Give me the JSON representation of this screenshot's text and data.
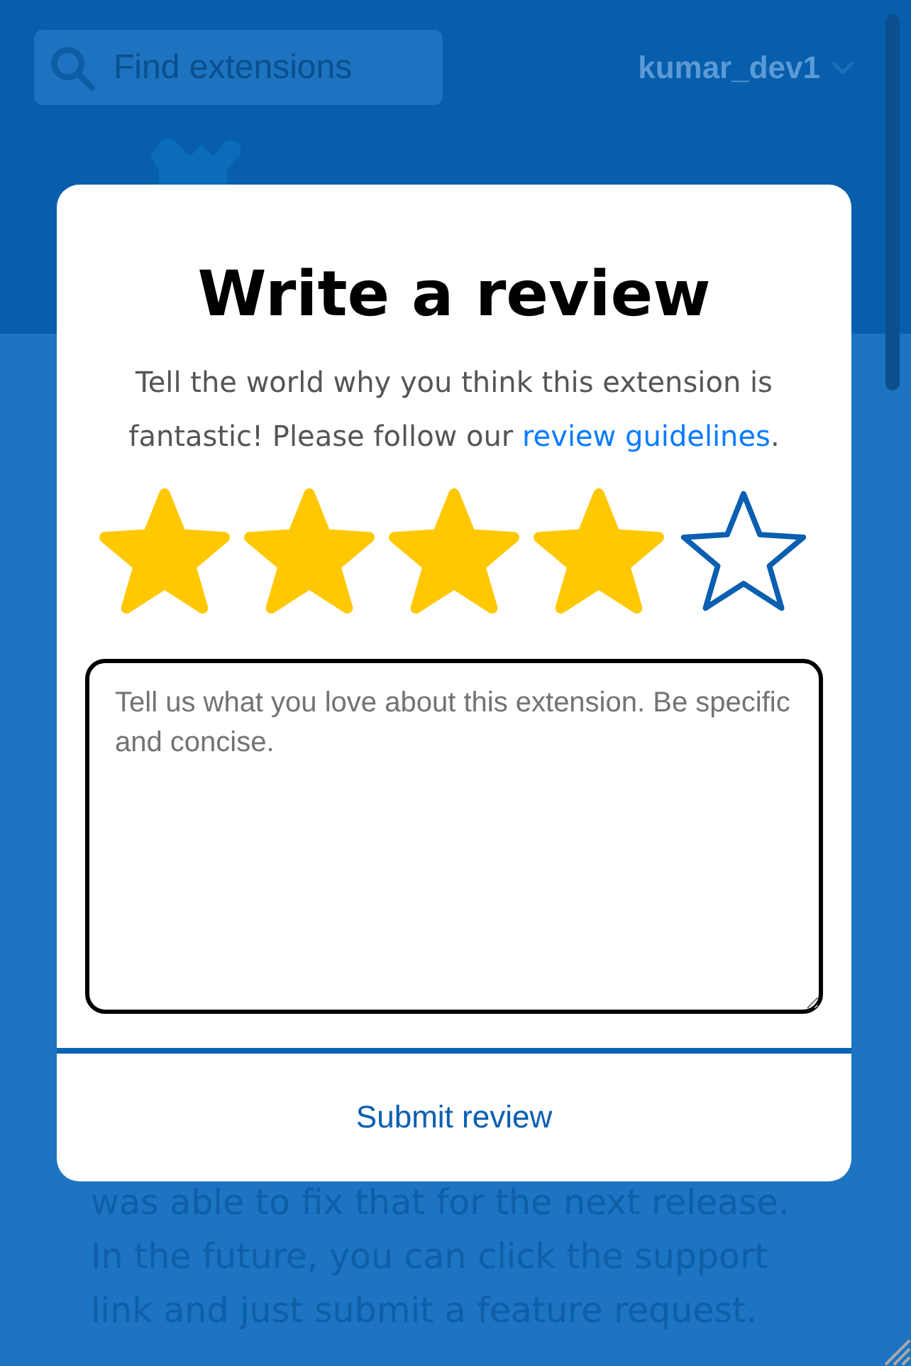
{
  "header": {
    "search_placeholder": "Find extensions",
    "username": "kumar_dev1"
  },
  "background_text": "was able to fix that for the next release. In the future, you can click the support link and just submit a feature request.",
  "dialog": {
    "title": "Write a review",
    "description_before": "Tell the world why you think this extension is fantastic! Please follow our ",
    "description_link": "review guidelines",
    "description_after": ".",
    "rating": {
      "stars": 4
    },
    "review_field": {
      "placeholder": "Tell us what you love about this extension. Be specific and concise."
    },
    "submit_label": "Submit review"
  }
}
